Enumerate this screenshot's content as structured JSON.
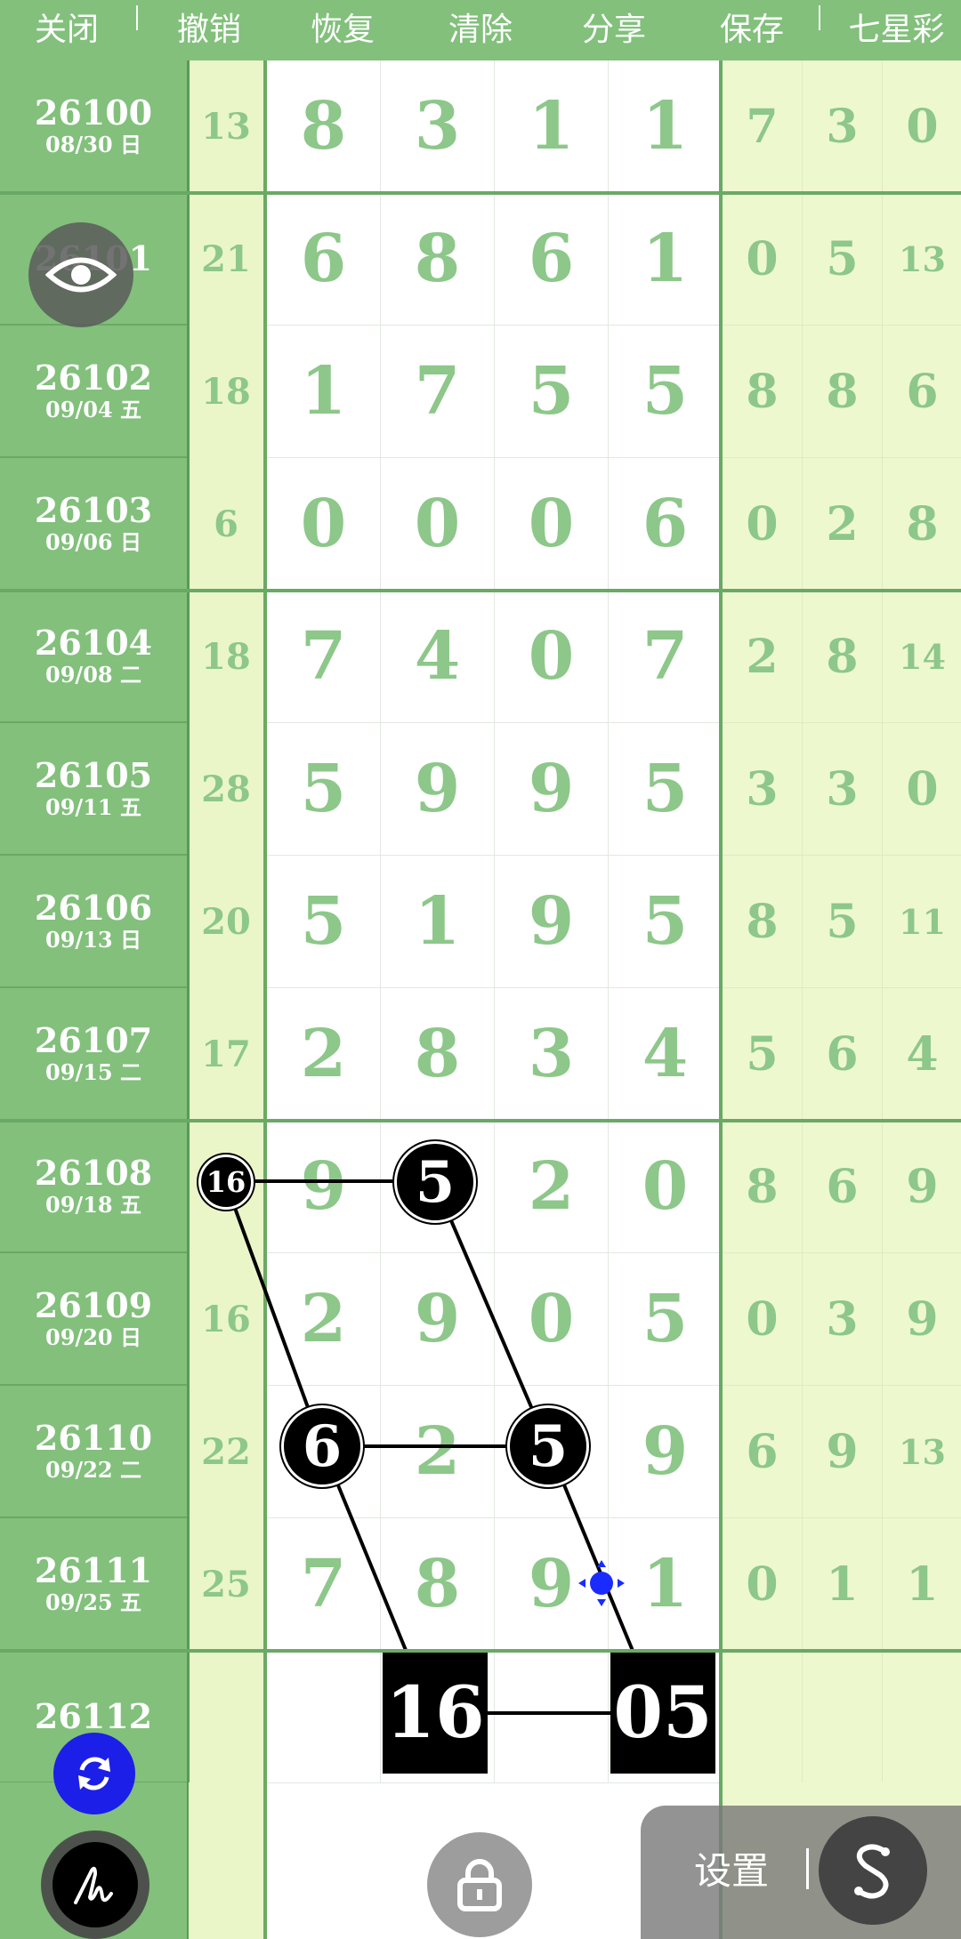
{
  "toolbar": {
    "close": "关闭",
    "undo": "撤销",
    "redo": "恢复",
    "clear": "清除",
    "share": "分享",
    "save": "保存",
    "game": "七星彩"
  },
  "rows": [
    {
      "id": "26100",
      "date": "08/30 日",
      "sum": "13",
      "d": [
        "8",
        "3",
        "1",
        "1"
      ],
      "x": [
        "7",
        "3",
        "0"
      ]
    },
    {
      "id": "26101",
      "date": "",
      "sum": "21",
      "d": [
        "6",
        "8",
        "6",
        "1"
      ],
      "x": [
        "0",
        "5",
        "13"
      ]
    },
    {
      "id": "26102",
      "date": "09/04 五",
      "sum": "18",
      "d": [
        "1",
        "7",
        "5",
        "5"
      ],
      "x": [
        "8",
        "8",
        "6"
      ]
    },
    {
      "id": "26103",
      "date": "09/06 日",
      "sum": "6",
      "d": [
        "0",
        "0",
        "0",
        "6"
      ],
      "x": [
        "0",
        "2",
        "8"
      ]
    },
    {
      "id": "26104",
      "date": "09/08 二",
      "sum": "18",
      "d": [
        "7",
        "4",
        "0",
        "7"
      ],
      "x": [
        "2",
        "8",
        "14"
      ]
    },
    {
      "id": "26105",
      "date": "09/11 五",
      "sum": "28",
      "d": [
        "5",
        "9",
        "9",
        "5"
      ],
      "x": [
        "3",
        "3",
        "0"
      ]
    },
    {
      "id": "26106",
      "date": "09/13 日",
      "sum": "20",
      "d": [
        "5",
        "1",
        "9",
        "5"
      ],
      "x": [
        "8",
        "5",
        "11"
      ]
    },
    {
      "id": "26107",
      "date": "09/15 二",
      "sum": "17",
      "d": [
        "2",
        "8",
        "3",
        "4"
      ],
      "x": [
        "5",
        "6",
        "4"
      ]
    },
    {
      "id": "26108",
      "date": "09/18 五",
      "sum": "",
      "d": [
        "9",
        "",
        "2",
        "0"
      ],
      "x": [
        "8",
        "6",
        "9"
      ]
    },
    {
      "id": "26109",
      "date": "09/20 日",
      "sum": "16",
      "d": [
        "2",
        "9",
        "0",
        "5"
      ],
      "x": [
        "0",
        "3",
        "9"
      ]
    },
    {
      "id": "26110",
      "date": "09/22 二",
      "sum": "22",
      "d": [
        "",
        "2",
        "",
        "9"
      ],
      "x": [
        "6",
        "9",
        "13"
      ]
    },
    {
      "id": "26111",
      "date": "09/25 五",
      "sum": "25",
      "d": [
        "7",
        "8",
        "9",
        "1"
      ],
      "x": [
        "0",
        "1",
        "1"
      ]
    },
    {
      "id": "26112",
      "date": "",
      "sum": "",
      "d": [
        "",
        "",
        "",
        ""
      ],
      "x": [
        "",
        "",
        ""
      ]
    }
  ],
  "markers": {
    "b1": "16",
    "b2": "5",
    "b3": "6",
    "b4": "5",
    "s1": "16",
    "s2": "05"
  },
  "panel": {
    "settings": "设置"
  },
  "colors": {
    "green": "#82c07c",
    "digit": "#8dc78a",
    "pale": "#eef8cf",
    "blue": "#1a2bff"
  }
}
